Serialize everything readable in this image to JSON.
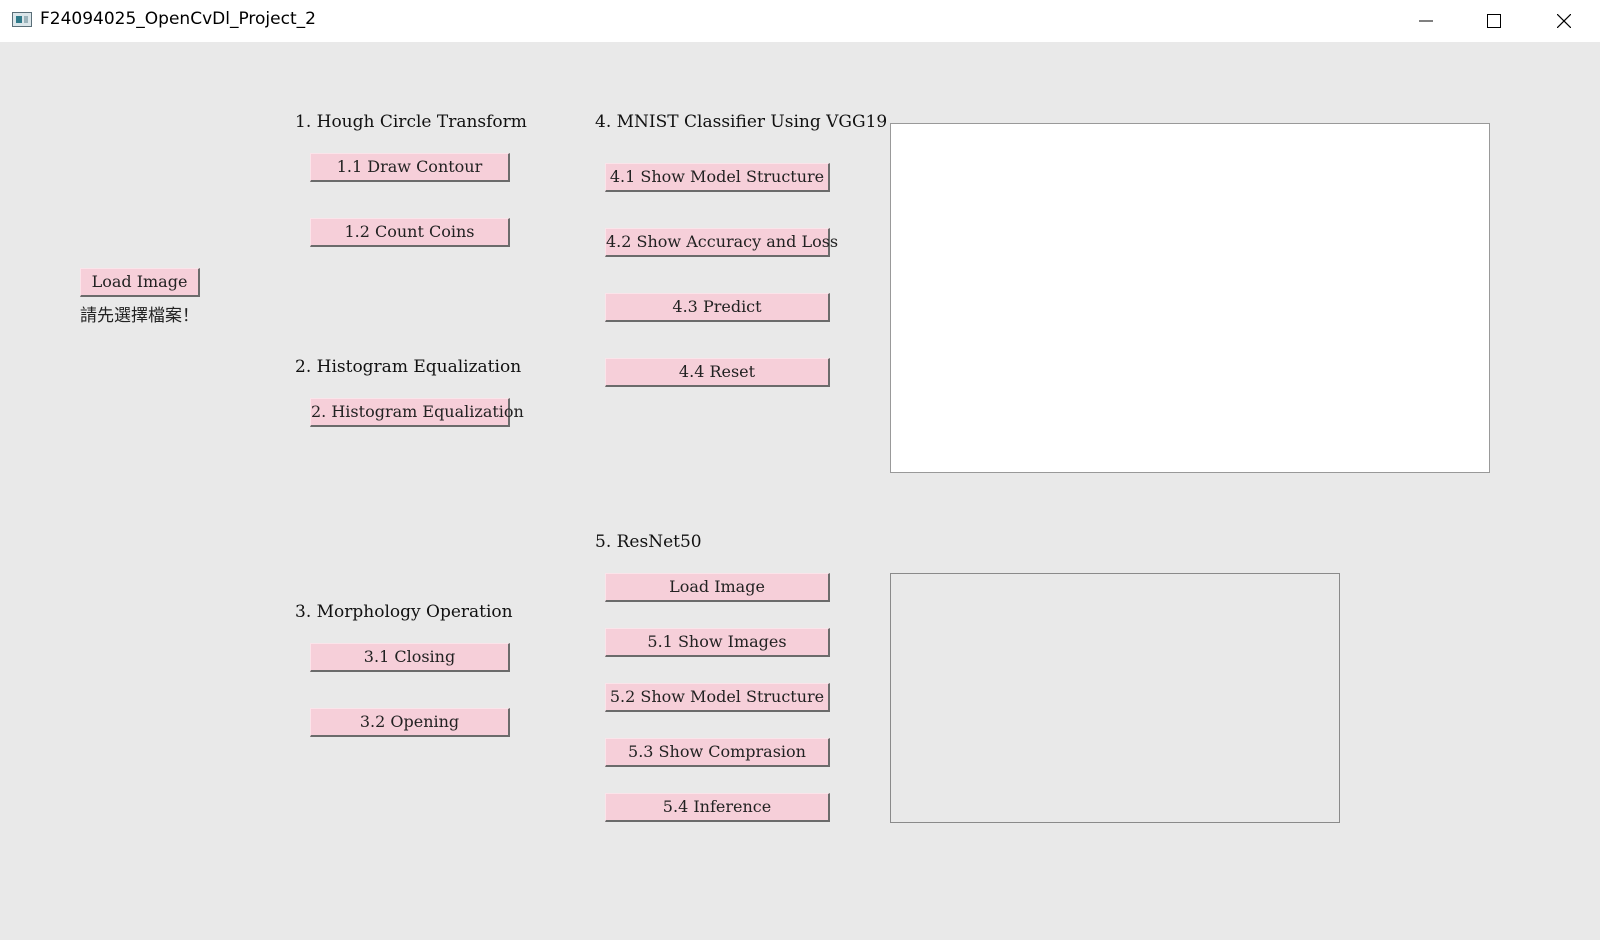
{
  "window": {
    "title": "F24094025_OpenCvDl_Project_2",
    "icon": "app-window-icon",
    "controls": [
      "minimize-icon",
      "maximize-icon",
      "close-icon"
    ]
  },
  "left": {
    "load_image_label": "Load Image",
    "status_text": "請先選擇檔案！"
  },
  "section1": {
    "title": "1. Hough Circle Transform",
    "buttons": [
      "1.1 Draw Contour",
      "1.2 Count Coins"
    ]
  },
  "section2": {
    "title": "2. Histogram Equalization",
    "buttons": [
      "2. Histogram Equalization"
    ]
  },
  "section3": {
    "title": "3. Morphology Operation",
    "buttons": [
      "3.1 Closing",
      "3.2 Opening"
    ]
  },
  "section4": {
    "title": "4. MNIST Classifier Using VGG19",
    "buttons": [
      "4.1 Show Model Structure",
      "4.2 Show Accuracy and Loss",
      "4.3 Predict",
      "4.4 Reset"
    ]
  },
  "section5": {
    "title": "5. ResNet50",
    "buttons": [
      "Load Image",
      "5.1 Show Images",
      "5.2 Show Model Structure",
      "5.3 Show Comprasion",
      "5.4 Inference"
    ]
  },
  "colors": {
    "background": "#e9e9e9",
    "button": "#f6cfd9",
    "canvas": "#ffffff"
  }
}
